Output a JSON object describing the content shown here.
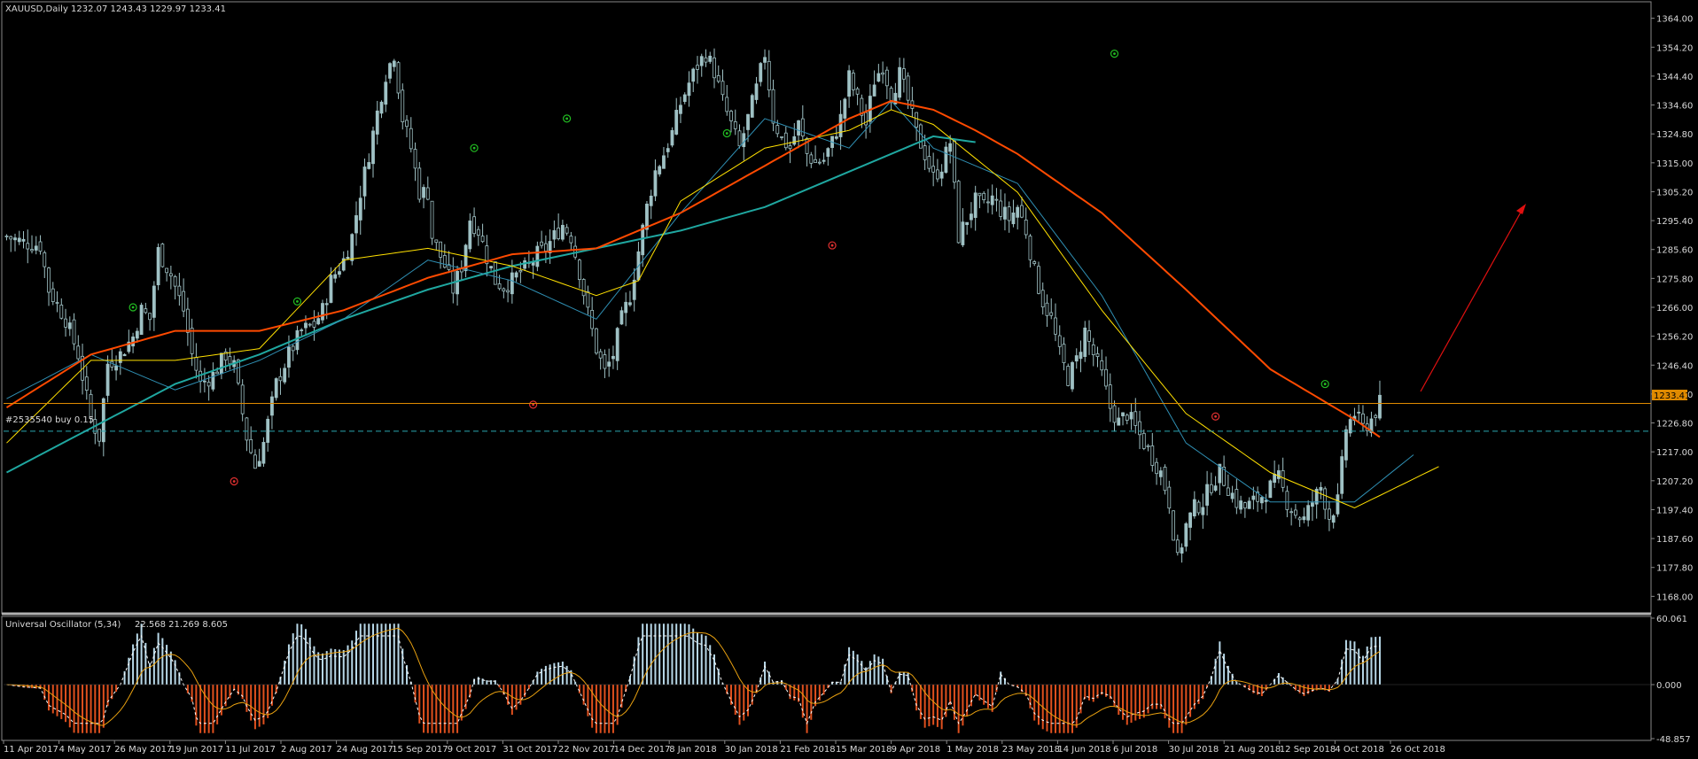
{
  "main_header": {
    "symbol": "XAUUSD,Daily",
    "ohlc": "1232.07 1243.43 1229.97 1233.41"
  },
  "order_label": "#2535540 buy 0.15",
  "current_price_label": "1233.41",
  "osc_header": {
    "name": "Universal Oscillator (5,34)",
    "values": "22.568 21.269 8.605"
  },
  "colors": {
    "background": "#000000",
    "plot_bg": "#151515",
    "bull_candle": "#9fc1c4",
    "bear_candle": "#000000",
    "bull_osc": "#b8d8e8",
    "bear_osc": "#e0501e",
    "price_line": "#e08a00",
    "order_line": "#2aa7b0",
    "ma_slow": "#ff4a00",
    "ma_mid": "#ffe000",
    "ma_fast": "#2f8fb3",
    "ma_long": "#1fa7a0",
    "signal_up": "#22bb22",
    "signal_down": "#e03030",
    "arrow": "#e01010"
  },
  "chart_data": {
    "type": "candlestick",
    "title": "XAUUSD,Daily",
    "ylim": [
      1163.0,
      1369.0
    ],
    "y_ticks": [
      "1364.00",
      "1354.20",
      "1344.40",
      "1334.60",
      "1324.80",
      "1315.00",
      "1305.20",
      "1295.40",
      "1285.60",
      "1275.80",
      "1266.00",
      "1256.20",
      "1246.40",
      "1236.60",
      "1226.80",
      "1217.00",
      "1207.20",
      "1197.40",
      "1187.60",
      "1177.80",
      "1168.00"
    ],
    "x_ticks": [
      "11 Apr 2017",
      "4 May 2017",
      "26 May 2017",
      "19 Jun 2017",
      "11 Jul 2017",
      "2 Aug 2017",
      "24 Aug 2017",
      "15 Sep 2017",
      "9 Oct 2017",
      "31 Oct 2017",
      "22 Nov 2017",
      "14 Dec 2017",
      "8 Jan 2018",
      "30 Jan 2018",
      "21 Feb 2018",
      "15 Mar 2018",
      "9 Apr 2018",
      "1 May 2018",
      "23 May 2018",
      "14 Jun 2018",
      "6 Jul 2018",
      "30 Jul 2018",
      "21 Aug 2018",
      "12 Sep 2018",
      "4 Oct 2018",
      "26 Oct 2018"
    ],
    "current_price": 1233.41,
    "order_price": 1224.0,
    "close_path": [
      [
        0,
        1290
      ],
      [
        4,
        1288
      ],
      [
        8,
        1287
      ],
      [
        10,
        1272
      ],
      [
        14,
        1262
      ],
      [
        17,
        1250
      ],
      [
        20,
        1228
      ],
      [
        22,
        1222
      ],
      [
        24,
        1247
      ],
      [
        27,
        1250
      ],
      [
        30,
        1256
      ],
      [
        32,
        1265
      ],
      [
        34,
        1262
      ],
      [
        36,
        1285
      ],
      [
        39,
        1277
      ],
      [
        42,
        1265
      ],
      [
        44,
        1250
      ],
      [
        46,
        1240
      ],
      [
        49,
        1243
      ],
      [
        52,
        1250
      ],
      [
        54,
        1246
      ],
      [
        57,
        1222
      ],
      [
        59,
        1212
      ],
      [
        61,
        1220
      ],
      [
        64,
        1240
      ],
      [
        67,
        1250
      ],
      [
        70,
        1258
      ],
      [
        73,
        1260
      ],
      [
        75,
        1265
      ],
      [
        77,
        1275
      ],
      [
        80,
        1282
      ],
      [
        82,
        1290
      ],
      [
        84,
        1305
      ],
      [
        86,
        1318
      ],
      [
        88,
        1332
      ],
      [
        90,
        1345
      ],
      [
        92,
        1352
      ],
      [
        94,
        1330
      ],
      [
        96,
        1320
      ],
      [
        98,
        1305
      ],
      [
        100,
        1305
      ],
      [
        101,
        1290
      ],
      [
        104,
        1280
      ],
      [
        106,
        1272
      ],
      [
        108,
        1280
      ],
      [
        110,
        1296
      ],
      [
        112,
        1292
      ],
      [
        114,
        1283
      ],
      [
        116,
        1275
      ],
      [
        118,
        1273
      ],
      [
        120,
        1275
      ],
      [
        122,
        1278
      ],
      [
        124,
        1280
      ],
      [
        126,
        1284
      ],
      [
        128,
        1286
      ],
      [
        130,
        1290
      ],
      [
        132,
        1294
      ],
      [
        134,
        1290
      ],
      [
        136,
        1278
      ],
      [
        138,
        1264
      ],
      [
        140,
        1252
      ],
      [
        142,
        1244
      ],
      [
        144,
        1250
      ],
      [
        146,
        1262
      ],
      [
        148,
        1270
      ],
      [
        150,
        1285
      ],
      [
        152,
        1300
      ],
      [
        154,
        1312
      ],
      [
        156,
        1318
      ],
      [
        158,
        1325
      ],
      [
        160,
        1335
      ],
      [
        162,
        1342
      ],
      [
        164,
        1348
      ],
      [
        166,
        1352
      ],
      [
        168,
        1346
      ],
      [
        170,
        1336
      ],
      [
        172,
        1328
      ],
      [
        174,
        1320
      ],
      [
        176,
        1330
      ],
      [
        178,
        1340
      ],
      [
        180,
        1352
      ],
      [
        182,
        1330
      ],
      [
        184,
        1323
      ],
      [
        186,
        1320
      ],
      [
        188,
        1328
      ],
      [
        190,
        1318
      ],
      [
        192,
        1315
      ],
      [
        194,
        1316
      ],
      [
        196,
        1322
      ],
      [
        198,
        1330
      ],
      [
        200,
        1344
      ],
      [
        202,
        1336
      ],
      [
        204,
        1328
      ],
      [
        206,
        1343
      ],
      [
        208,
        1348
      ],
      [
        210,
        1338
      ],
      [
        212,
        1345
      ],
      [
        214,
        1336
      ],
      [
        216,
        1325
      ],
      [
        218,
        1318
      ],
      [
        220,
        1310
      ],
      [
        222,
        1314
      ],
      [
        224,
        1322
      ],
      [
        226,
        1290
      ],
      [
        228,
        1296
      ],
      [
        230,
        1302
      ],
      [
        232,
        1300
      ],
      [
        234,
        1303
      ],
      [
        236,
        1299
      ],
      [
        238,
        1296
      ],
      [
        240,
        1300
      ],
      [
        242,
        1292
      ],
      [
        244,
        1278
      ],
      [
        246,
        1268
      ],
      [
        248,
        1262
      ],
      [
        250,
        1250
      ],
      [
        252,
        1242
      ],
      [
        254,
        1248
      ],
      [
        256,
        1258
      ],
      [
        258,
        1250
      ],
      [
        260,
        1243
      ],
      [
        262,
        1232
      ],
      [
        264,
        1227
      ],
      [
        266,
        1230
      ],
      [
        268,
        1225
      ],
      [
        270,
        1220
      ],
      [
        272,
        1215
      ],
      [
        274,
        1210
      ],
      [
        276,
        1200
      ],
      [
        278,
        1180
      ],
      [
        280,
        1192
      ],
      [
        282,
        1198
      ],
      [
        284,
        1200
      ],
      [
        286,
        1206
      ],
      [
        288,
        1210
      ],
      [
        290,
        1205
      ],
      [
        292,
        1200
      ],
      [
        294,
        1198
      ],
      [
        296,
        1200
      ],
      [
        298,
        1202
      ],
      [
        300,
        1205
      ],
      [
        302,
        1208
      ],
      [
        304,
        1200
      ],
      [
        306,
        1196
      ],
      [
        308,
        1194
      ],
      [
        310,
        1200
      ],
      [
        312,
        1205
      ],
      [
        314,
        1195
      ],
      [
        316,
        1200
      ],
      [
        318,
        1225
      ],
      [
        320,
        1230
      ],
      [
        322,
        1225
      ],
      [
        324,
        1228
      ],
      [
        326,
        1233.41
      ]
    ],
    "ma_slow_path": [
      [
        0,
        1232
      ],
      [
        20,
        1250
      ],
      [
        40,
        1258
      ],
      [
        60,
        1258
      ],
      [
        80,
        1265
      ],
      [
        100,
        1276
      ],
      [
        120,
        1284
      ],
      [
        140,
        1286
      ],
      [
        160,
        1298
      ],
      [
        180,
        1314
      ],
      [
        200,
        1330
      ],
      [
        210,
        1336
      ],
      [
        220,
        1333
      ],
      [
        230,
        1326
      ],
      [
        240,
        1318
      ],
      [
        260,
        1298
      ],
      [
        280,
        1272
      ],
      [
        300,
        1245
      ],
      [
        320,
        1228
      ],
      [
        326,
        1222
      ]
    ],
    "ma_mid_path": [
      [
        0,
        1220
      ],
      [
        20,
        1248
      ],
      [
        40,
        1248
      ],
      [
        60,
        1252
      ],
      [
        80,
        1282
      ],
      [
        100,
        1286
      ],
      [
        120,
        1280
      ],
      [
        140,
        1270
      ],
      [
        150,
        1275
      ],
      [
        160,
        1302
      ],
      [
        180,
        1320
      ],
      [
        200,
        1326
      ],
      [
        210,
        1333
      ],
      [
        220,
        1328
      ],
      [
        240,
        1305
      ],
      [
        260,
        1265
      ],
      [
        280,
        1230
      ],
      [
        300,
        1210
      ],
      [
        320,
        1198
      ],
      [
        340,
        1212
      ]
    ],
    "ma_fast_path": [
      [
        0,
        1235
      ],
      [
        20,
        1250
      ],
      [
        40,
        1238
      ],
      [
        60,
        1248
      ],
      [
        80,
        1262
      ],
      [
        100,
        1282
      ],
      [
        120,
        1275
      ],
      [
        140,
        1262
      ],
      [
        160,
        1298
      ],
      [
        180,
        1330
      ],
      [
        200,
        1320
      ],
      [
        210,
        1336
      ],
      [
        220,
        1320
      ],
      [
        240,
        1308
      ],
      [
        260,
        1270
      ],
      [
        280,
        1220
      ],
      [
        300,
        1200
      ],
      [
        320,
        1200
      ],
      [
        334,
        1216
      ]
    ],
    "ma_long_path": [
      [
        0,
        1210
      ],
      [
        20,
        1225
      ],
      [
        40,
        1240
      ],
      [
        60,
        1250
      ],
      [
        80,
        1262
      ],
      [
        100,
        1272
      ],
      [
        120,
        1280
      ],
      [
        140,
        1286
      ],
      [
        160,
        1292
      ],
      [
        180,
        1300
      ],
      [
        200,
        1312
      ],
      [
        210,
        1318
      ],
      [
        220,
        1324
      ],
      [
        230,
        1322
      ]
    ],
    "oscillator": {
      "name": "Universal Oscillator (5,34)",
      "values": [
        22.568,
        21.269,
        8.605
      ],
      "ylim": [
        -48.857,
        60.061
      ],
      "y_ticks": [
        "60.061",
        "0.000",
        "-48.857"
      ]
    }
  }
}
